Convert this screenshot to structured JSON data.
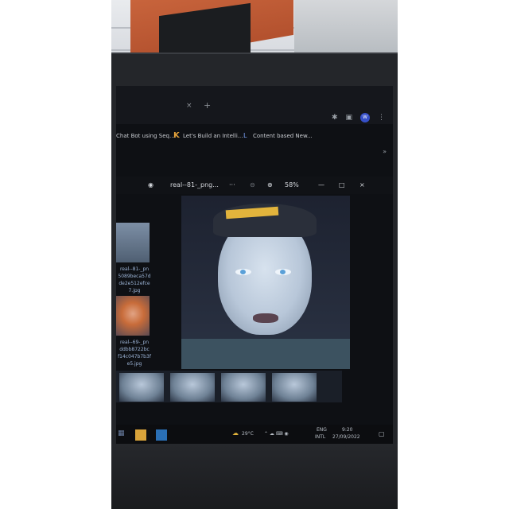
{
  "colors": {
    "accent": "#3650c8",
    "bookmark_k": "#e6a43c",
    "cap": "#e2b43c"
  },
  "browser": {
    "tab_close": "×",
    "tab_add": "+",
    "bookmarks": [
      {
        "label": "Chat Bot using Seq..."
      },
      {
        "label": "Let's Build an Intelli..."
      },
      {
        "label": "Content based New..."
      }
    ],
    "more": "»",
    "avatar_letter": "W"
  },
  "viewer": {
    "filename": "real--81-_png...",
    "more": "···",
    "zoom_label": "58%",
    "minimize": "—",
    "maximize": "□",
    "close": "×"
  },
  "sidebar": {
    "items": [
      {
        "caption": "real--81-_pn 5089beca57d de2e512efce 7.jpg"
      },
      {
        "caption": "real--69-_pn ddbb8722bc f14c047b7b3f e5.jpg"
      }
    ]
  },
  "taskbar": {
    "temperature": "29°C",
    "lang_top": "ENG",
    "lang_bottom": "INTL",
    "time": "9:20",
    "date": "27/09/2022"
  }
}
